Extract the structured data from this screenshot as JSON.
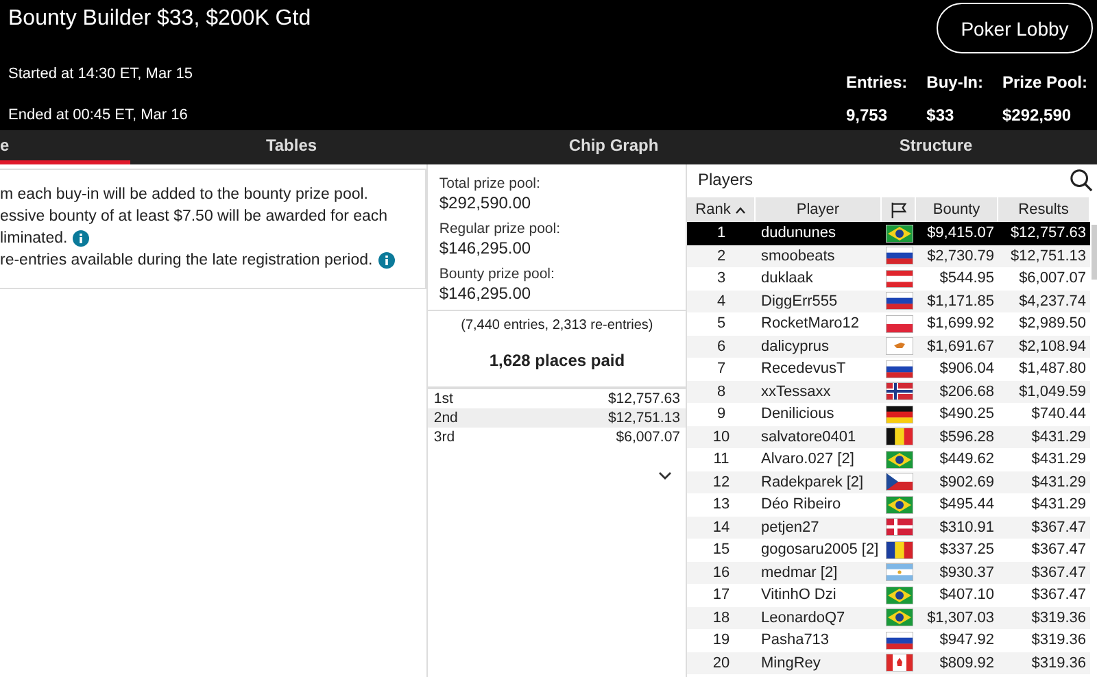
{
  "header": {
    "title": "Bounty Builder $33, $200K Gtd",
    "started": "Started at 14:30 ET, Mar 15",
    "ended": "Ended at 00:45 ET, Mar 16",
    "lobby_button": "Poker Lobby",
    "stats": [
      {
        "label": "Entries:",
        "value": "9,753"
      },
      {
        "label": "Buy-In:",
        "value": "$33"
      },
      {
        "label": "Prize Pool:",
        "value": "$292,590"
      }
    ]
  },
  "tabs": [
    {
      "label": "e",
      "selected": true
    },
    {
      "label": "Tables",
      "selected": false
    },
    {
      "label": "Chip Graph",
      "selected": false
    },
    {
      "label": "Structure",
      "selected": false
    }
  ],
  "info_lines": [
    {
      "text": "m each buy-in will be added to the bounty prize pool.",
      "info": false
    },
    {
      "text": "essive bounty of at least $7.50 will be awarded for each",
      "info": false
    },
    {
      "text": "liminated.",
      "info": true
    },
    {
      "text": "re-entries available during the late registration period.",
      "info": true
    }
  ],
  "prize_pools": [
    {
      "label": "Total prize pool:",
      "value": "$292,590.00"
    },
    {
      "label": "Regular prize pool:",
      "value": "$146,295.00"
    },
    {
      "label": "Bounty prize pool:",
      "value": "$146,295.00"
    }
  ],
  "entries_note": "(7,440 entries, 2,313 re-entries)",
  "places_paid": "1,628 places paid",
  "payouts": [
    {
      "place": "1st",
      "amount": "$12,757.63"
    },
    {
      "place": "2nd",
      "amount": "$12,751.13"
    },
    {
      "place": "3rd",
      "amount": "$6,007.07"
    }
  ],
  "players": {
    "title": "Players",
    "columns": [
      {
        "label": "Rank",
        "sorted": true
      },
      {
        "label": "Player",
        "sorted": false
      },
      {
        "label": "Bounty",
        "sorted": false
      },
      {
        "label": "Results",
        "sorted": false
      }
    ],
    "rows": [
      {
        "rank": "1",
        "player": "dudununes",
        "flag": {
          "kind": "br"
        },
        "bounty": "$9,415.07",
        "result": "$12,757.63",
        "selected": true
      },
      {
        "rank": "2",
        "player": "smoobeats",
        "flag": {
          "kind": "ru"
        },
        "bounty": "$2,730.79",
        "result": "$12,751.13",
        "selected": false
      },
      {
        "rank": "3",
        "player": "duklaak",
        "flag": {
          "kind": "at"
        },
        "bounty": "$544.95",
        "result": "$6,007.07",
        "selected": false
      },
      {
        "rank": "4",
        "player": "DiggErr555",
        "flag": {
          "kind": "ru"
        },
        "bounty": "$1,171.85",
        "result": "$4,237.74",
        "selected": false
      },
      {
        "rank": "5",
        "player": "RocketMaro12",
        "flag": {
          "kind": "pl"
        },
        "bounty": "$1,699.92",
        "result": "$2,989.50",
        "selected": false
      },
      {
        "rank": "6",
        "player": "dalicyprus",
        "flag": {
          "kind": "cy"
        },
        "bounty": "$1,691.67",
        "result": "$2,108.94",
        "selected": false
      },
      {
        "rank": "7",
        "player": "RecedevusT",
        "flag": {
          "kind": "ru"
        },
        "bounty": "$906.04",
        "result": "$1,487.80",
        "selected": false
      },
      {
        "rank": "8",
        "player": "xxTessaxx",
        "flag": {
          "kind": "no"
        },
        "bounty": "$206.68",
        "result": "$1,049.59",
        "selected": false
      },
      {
        "rank": "9",
        "player": "Denilicious",
        "flag": {
          "kind": "de"
        },
        "bounty": "$490.25",
        "result": "$740.44",
        "selected": false
      },
      {
        "rank": "10",
        "player": "salvatore0401",
        "flag": {
          "kind": "be"
        },
        "bounty": "$596.28",
        "result": "$431.29",
        "selected": false
      },
      {
        "rank": "11",
        "player": "Alvaro.027 [2]",
        "flag": {
          "kind": "br"
        },
        "bounty": "$449.62",
        "result": "$431.29",
        "selected": false
      },
      {
        "rank": "12",
        "player": "Radekparek [2]",
        "flag": {
          "kind": "cz"
        },
        "bounty": "$902.69",
        "result": "$431.29",
        "selected": false
      },
      {
        "rank": "13",
        "player": "Déo Ribeiro",
        "flag": {
          "kind": "br"
        },
        "bounty": "$495.44",
        "result": "$431.29",
        "selected": false
      },
      {
        "rank": "14",
        "player": "petjen27",
        "flag": {
          "kind": "dk"
        },
        "bounty": "$310.91",
        "result": "$367.47",
        "selected": false
      },
      {
        "rank": "15",
        "player": "gogosaru2005 [2]",
        "flag": {
          "kind": "ro"
        },
        "bounty": "$337.25",
        "result": "$367.47",
        "selected": false
      },
      {
        "rank": "16",
        "player": "medmar [2]",
        "flag": {
          "kind": "ar"
        },
        "bounty": "$930.37",
        "result": "$367.47",
        "selected": false
      },
      {
        "rank": "17",
        "player": "VitinhO Dzi",
        "flag": {
          "kind": "br"
        },
        "bounty": "$407.10",
        "result": "$367.47",
        "selected": false
      },
      {
        "rank": "18",
        "player": "LeonardoQ7",
        "flag": {
          "kind": "br"
        },
        "bounty": "$1,307.03",
        "result": "$319.36",
        "selected": false
      },
      {
        "rank": "19",
        "player": "Pasha713",
        "flag": {
          "kind": "ru"
        },
        "bounty": "$947.92",
        "result": "$319.36",
        "selected": false
      },
      {
        "rank": "20",
        "player": "MingRey",
        "flag": {
          "kind": "ca"
        },
        "bounty": "$809.92",
        "result": "$319.36",
        "selected": false
      }
    ]
  }
}
